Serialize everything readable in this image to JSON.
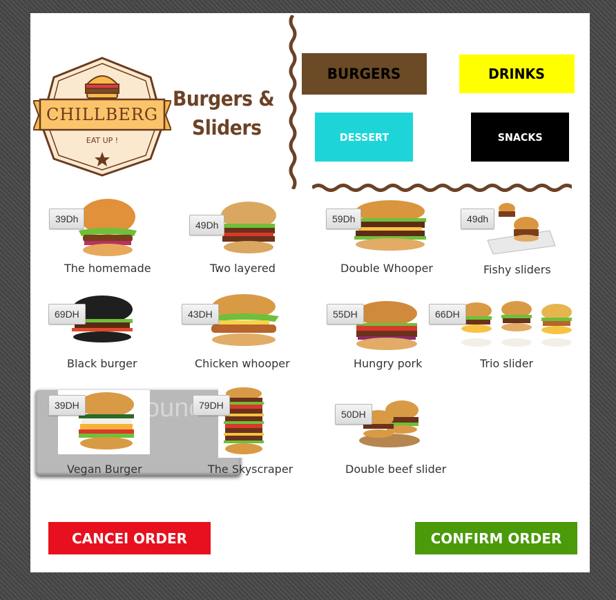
{
  "brand": {
    "logo_name": "CHILLBERG",
    "logo_tagline": "EAT UP !",
    "title_line1": "Burgers &",
    "title_line2": "Sliders",
    "brown": "#6b4226"
  },
  "categories": [
    {
      "label": "BURGERS",
      "bg": "#6b4a26",
      "color": "#000000"
    },
    {
      "label": "DRINKS",
      "bg": "#ffff00",
      "color": "#000000"
    },
    {
      "label": "DESSERT",
      "bg": "#1dd5d8",
      "color": "#ffffff"
    },
    {
      "label": "SNACKS",
      "bg": "#000000",
      "color": "#ffffff"
    }
  ],
  "items": [
    {
      "name": "The homemade",
      "price": "39Dh"
    },
    {
      "name": "Two layered",
      "price": "49Dh"
    },
    {
      "name": "Double Whooper",
      "price": "59Dh"
    },
    {
      "name": "Fishy sliders",
      "price": "49dh"
    },
    {
      "name": "Black burger",
      "price": "69DH"
    },
    {
      "name": "Chicken whooper",
      "price": "43DH"
    },
    {
      "name": "Hungry pork",
      "price": "55DH"
    },
    {
      "name": "Trio slider",
      "price": "66DH"
    },
    {
      "name": "Vegan Burger",
      "price": "39DH"
    },
    {
      "name": "The Skyscraper",
      "price": "79DH"
    },
    {
      "name": "Double beef slider",
      "price": "50DH"
    }
  ],
  "actions": {
    "cancel_label": "CANCEl ORDER",
    "cancel_color": "#e8101e",
    "confirm_label": "CONFIRM ORDER",
    "confirm_color": "#4a9a0a"
  }
}
